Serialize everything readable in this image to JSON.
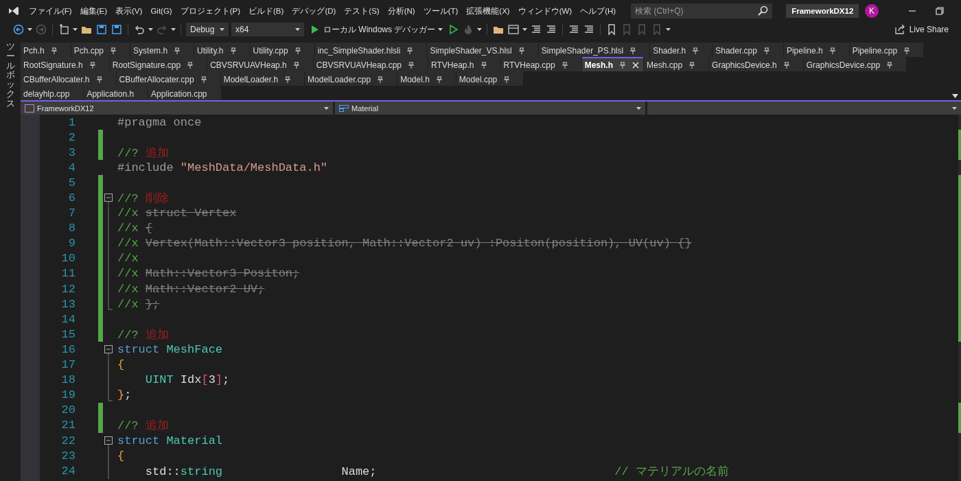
{
  "menu": [
    "ファイル(F)",
    "編集(E)",
    "表示(V)",
    "Git(G)",
    "プロジェクト(P)",
    "ビルド(B)",
    "デバッグ(D)",
    "テスト(S)",
    "分析(N)",
    "ツール(T)",
    "拡張機能(X)",
    "ウィンドウ(W)",
    "ヘルプ(H)"
  ],
  "search": {
    "placeholder": "検索 (Ctrl+Q)"
  },
  "solution_name": "FrameworkDX12",
  "account": {
    "initial": "K"
  },
  "toolbar": {
    "configuration": "Debug",
    "platform": "x64",
    "run_label": "ローカル Windows デバッガー",
    "live_share": "Live Share"
  },
  "toolbox_label": "ツールボックス",
  "tab_rows": [
    [
      {
        "label": "Pch.h",
        "selected": false,
        "pinned": true
      },
      {
        "label": "Pch.cpp",
        "selected": false,
        "pinned": true
      },
      {
        "label": "System.h",
        "selected": false,
        "pinned": true
      },
      {
        "label": "Utility.h",
        "selected": false,
        "pinned": true
      },
      {
        "label": "Utility.cpp",
        "selected": false,
        "pinned": true
      },
      {
        "label": "inc_SimpleShader.hlsli",
        "selected": false,
        "pinned": true
      },
      {
        "label": "SimpleShader_VS.hlsl",
        "selected": false,
        "pinned": true
      },
      {
        "label": "SimpleShader_PS.hlsl",
        "selected": false,
        "pinned": true
      },
      {
        "label": "Shader.h",
        "selected": false,
        "pinned": true
      },
      {
        "label": "Shader.cpp",
        "selected": false,
        "pinned": true
      },
      {
        "label": "Pipeline.h",
        "selected": false,
        "pinned": true
      },
      {
        "label": "Pipeline.cpp",
        "selected": false,
        "pinned": true
      }
    ],
    [
      {
        "label": "RootSignature.h",
        "selected": false,
        "pinned": true
      },
      {
        "label": "RootSignature.cpp",
        "selected": false,
        "pinned": true
      },
      {
        "label": "CBVSRVUAVHeap.h",
        "selected": false,
        "pinned": true
      },
      {
        "label": "CBVSRVUAVHeap.cpp",
        "selected": false,
        "pinned": true
      },
      {
        "label": "RTVHeap.h",
        "selected": false,
        "pinned": true
      },
      {
        "label": "RTVHeap.cpp",
        "selected": false,
        "pinned": true
      },
      {
        "label": "Mesh.h",
        "selected": true,
        "pinned": true
      },
      {
        "label": "Mesh.cpp",
        "selected": false,
        "pinned": true
      },
      {
        "label": "GraphicsDevice.h",
        "selected": false,
        "pinned": true
      },
      {
        "label": "GraphicsDevice.cpp",
        "selected": false,
        "pinned": true
      }
    ],
    [
      {
        "label": "CBufferAllocater.h",
        "selected": false,
        "pinned": true
      },
      {
        "label": "CBufferAllocater.cpp",
        "selected": false,
        "pinned": true
      },
      {
        "label": "ModelLoader.h",
        "selected": false,
        "pinned": true
      },
      {
        "label": "ModelLoader.cpp",
        "selected": false,
        "pinned": true
      },
      {
        "label": "Model.h",
        "selected": false,
        "pinned": true
      },
      {
        "label": "Model.cpp",
        "selected": false,
        "pinned": true
      }
    ],
    [
      {
        "label": "delayhlp.cpp",
        "selected": false,
        "pinned": false
      },
      {
        "label": "Application.h",
        "selected": false,
        "pinned": false
      },
      {
        "label": "Application.cpp",
        "selected": false,
        "pinned": false
      }
    ]
  ],
  "nav": {
    "project": "FrameworkDX12",
    "scope": "Material"
  },
  "code_lines": [
    {
      "number": "1",
      "changed": false,
      "kind": "plain",
      "tokens": [
        {
          "kind": "preprocessor",
          "text": "#pragma once"
        }
      ]
    },
    {
      "number": "2",
      "changed": true,
      "kind": "plain"
    },
    {
      "number": "3",
      "changed": true,
      "kind": "plain",
      "tokens": [
        {
          "kind": "comment",
          "text": "//? "
        },
        {
          "kind": "marker",
          "text": "追加"
        }
      ]
    },
    {
      "number": "4",
      "changed": false,
      "kind": "plain",
      "tokens": [
        {
          "kind": "preprocessor",
          "text": "#include "
        },
        {
          "kind": "string",
          "text": "\"MeshData/MeshData.h\""
        }
      ]
    },
    {
      "number": "5",
      "changed": true,
      "kind": "plain"
    },
    {
      "number": "6",
      "changed": true,
      "kind": "foldstart",
      "tokens": [
        {
          "kind": "comment",
          "text": "//? "
        },
        {
          "kind": "marker",
          "text": "削除"
        }
      ]
    },
    {
      "number": "7",
      "changed": true,
      "kind": "folded",
      "tokens": [
        {
          "kind": "comment",
          "text": "//x "
        },
        {
          "kind": "struck",
          "text": "struct Vertex"
        }
      ]
    },
    {
      "number": "8",
      "changed": true,
      "kind": "folded",
      "tokens": [
        {
          "kind": "comment",
          "text": "//x "
        },
        {
          "kind": "struck",
          "text": "{"
        }
      ]
    },
    {
      "number": "9",
      "changed": true,
      "kind": "folded",
      "tokens": [
        {
          "kind": "comment",
          "text": "//x "
        },
        {
          "kind": "struck",
          "text": "Vertex(Math::Vector3 position, Math::Vector2 uv) :Positon(position), UV(uv) {}"
        }
      ]
    },
    {
      "number": "10",
      "changed": true,
      "kind": "folded",
      "tokens": [
        {
          "kind": "comment",
          "text": "//x"
        }
      ]
    },
    {
      "number": "11",
      "changed": true,
      "kind": "folded",
      "tokens": [
        {
          "kind": "comment",
          "text": "//x "
        },
        {
          "kind": "struck",
          "text": "Math::Vector3 Positon;"
        }
      ]
    },
    {
      "number": "12",
      "changed": true,
      "kind": "folded",
      "tokens": [
        {
          "kind": "comment",
          "text": "//x "
        },
        {
          "kind": "struck",
          "text": "Math::Vector2 UV;"
        }
      ]
    },
    {
      "number": "13",
      "changed": true,
      "kind": "foldend",
      "tokens": [
        {
          "kind": "comment",
          "text": "//x "
        },
        {
          "kind": "struck",
          "text": "};"
        }
      ]
    },
    {
      "number": "14",
      "changed": true,
      "kind": "plain"
    },
    {
      "number": "15",
      "changed": true,
      "kind": "plain",
      "tokens": [
        {
          "kind": "comment",
          "text": "//? "
        },
        {
          "kind": "marker",
          "text": "追加"
        }
      ]
    },
    {
      "number": "16",
      "changed": false,
      "kind": "foldstart",
      "tokens": [
        {
          "kind": "keyword",
          "text": "struct "
        },
        {
          "kind": "type",
          "text": "MeshFace"
        }
      ]
    },
    {
      "number": "17",
      "changed": false,
      "kind": "folded",
      "tokens": [
        {
          "kind": "brace",
          "text": "{"
        }
      ]
    },
    {
      "number": "18",
      "changed": false,
      "kind": "folded",
      "tokens": [
        {
          "kind": "type",
          "text": "    UINT"
        },
        {
          "kind": "plain",
          "text": " Idx"
        },
        {
          "kind": "bracket",
          "text": "["
        },
        {
          "kind": "number",
          "text": "3"
        },
        {
          "kind": "bracket",
          "text": "]"
        },
        {
          "kind": "plain",
          "text": ";"
        }
      ]
    },
    {
      "number": "19",
      "changed": false,
      "kind": "foldend",
      "tokens": [
        {
          "kind": "brace",
          "text": "}"
        },
        {
          "kind": "plain",
          "text": ";"
        }
      ]
    },
    {
      "number": "20",
      "changed": true,
      "kind": "plain"
    },
    {
      "number": "21",
      "changed": true,
      "kind": "plain",
      "tokens": [
        {
          "kind": "comment",
          "text": "//? "
        },
        {
          "kind": "marker",
          "text": "追加"
        }
      ]
    },
    {
      "number": "22",
      "changed": false,
      "kind": "foldstart",
      "tokens": [
        {
          "kind": "keyword",
          "text": "struct "
        },
        {
          "kind": "type",
          "text": "Material"
        }
      ]
    },
    {
      "number": "23",
      "changed": false,
      "kind": "folded",
      "tokens": [
        {
          "kind": "brace",
          "text": "{"
        }
      ]
    },
    {
      "number": "24",
      "changed": false,
      "kind": "folded",
      "tokens": [
        {
          "kind": "plain",
          "text": "    std::"
        },
        {
          "kind": "type",
          "text": "string"
        },
        {
          "kind": "plain",
          "text": "                 Name;                                  "
        },
        {
          "kind": "comment",
          "text": "// マテリアルの名前"
        }
      ]
    }
  ]
}
